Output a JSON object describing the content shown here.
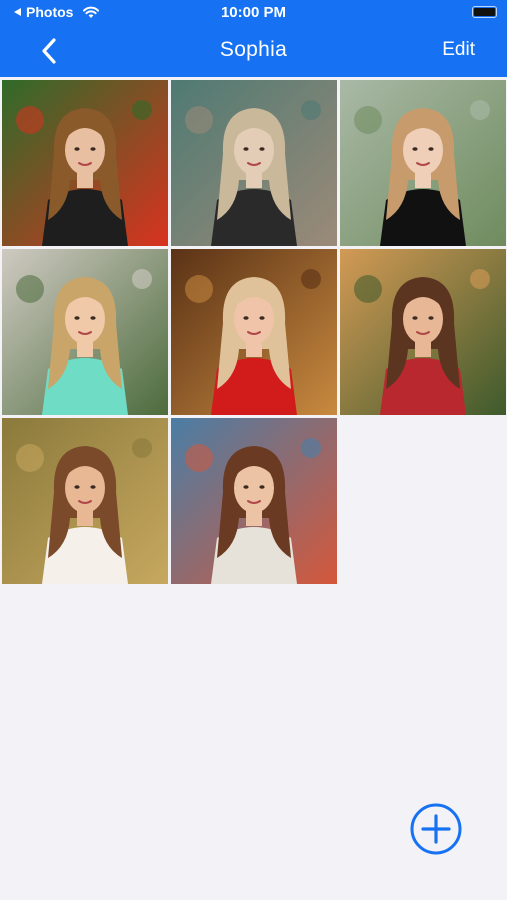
{
  "status_bar": {
    "back_app": "Photos",
    "time": "10:00 PM"
  },
  "nav": {
    "title": "Sophia",
    "edit_label": "Edit",
    "back_icon": "chevron-left-icon"
  },
  "colors": {
    "accent": "#1672f3",
    "background": "#f2f2f7"
  },
  "photos": [
    {
      "id": 1,
      "palette": {
        "bg": "#2f6b2a",
        "accent": "#d9321f",
        "hair": "#8a5a2b",
        "skin": "#e8bfa0",
        "top": "#1e1e1e"
      }
    },
    {
      "id": 2,
      "palette": {
        "bg": "#4f7a73",
        "accent": "#9c8a78",
        "hair": "#c9b89a",
        "skin": "#e4cdb6",
        "top": "#2a2a2a"
      }
    },
    {
      "id": 3,
      "palette": {
        "bg": "#a9b9a6",
        "accent": "#6f8b5e",
        "hair": "#c79b6c",
        "skin": "#efcfb8",
        "top": "#111111"
      }
    },
    {
      "id": 4,
      "palette": {
        "bg": "#cfcac2",
        "accent": "#4c6b3c",
        "hair": "#c9a56a",
        "skin": "#f0c9a8",
        "top": "#6fdcc6"
      }
    },
    {
      "id": 5,
      "palette": {
        "bg": "#5a3216",
        "accent": "#c98a3f",
        "hair": "#e0c29a",
        "skin": "#efc4a8",
        "top": "#d21c1c"
      }
    },
    {
      "id": 6,
      "palette": {
        "bg": "#d39a55",
        "accent": "#3e5a2c",
        "hair": "#5b3520",
        "skin": "#e8b896",
        "top": "#b8282e"
      }
    },
    {
      "id": 7,
      "palette": {
        "bg": "#8b7a3c",
        "accent": "#c7a85f",
        "hair": "#7a4a2a",
        "skin": "#e8b894",
        "top": "#f5f1ea"
      }
    },
    {
      "id": 8,
      "palette": {
        "bg": "#4a7ea6",
        "accent": "#d5573a",
        "hair": "#6b3a22",
        "skin": "#ecc3a4",
        "top": "#e6e2da"
      }
    }
  ],
  "add_button": {
    "icon": "plus-circle-icon"
  }
}
